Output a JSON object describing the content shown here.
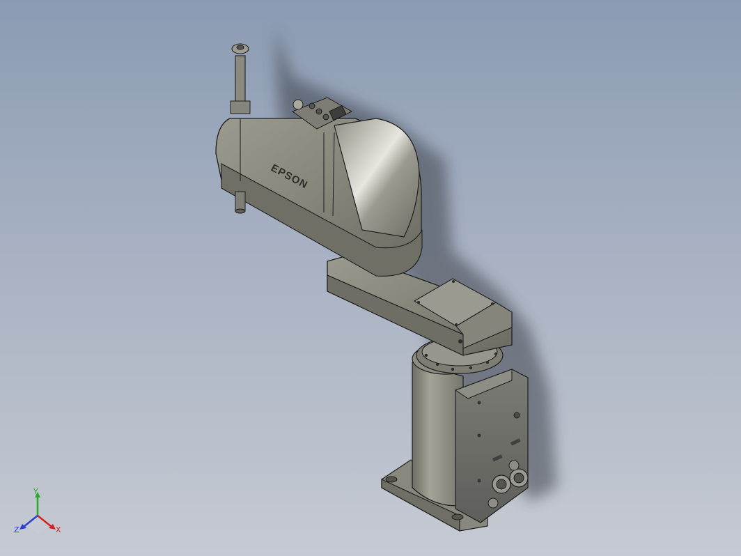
{
  "viewport": {
    "background_top": "#8b9bb3",
    "background_bottom": "#c6cad2"
  },
  "model": {
    "brand_label": "EPSON",
    "body_color": "#8a8a7e",
    "body_highlight": "#d8d8d0",
    "outline_color": "#1e1e1e",
    "connector_color": "#6d6d6a"
  },
  "triad": {
    "x_label": "X",
    "y_label": "Y",
    "z_label": "Z",
    "x_color": "#d42020",
    "y_color": "#2aa82a",
    "z_color": "#2a3fd4"
  }
}
